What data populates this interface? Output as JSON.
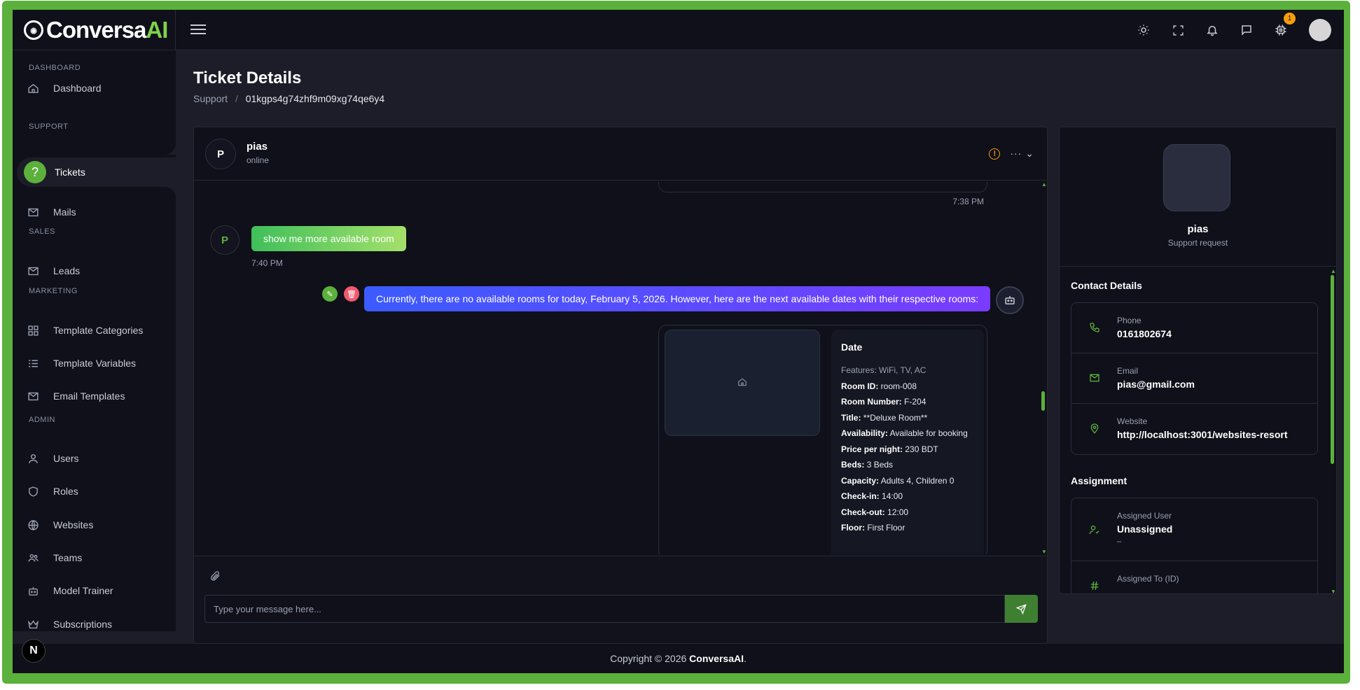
{
  "app": {
    "logo_text": "Conversa",
    "logo_accent": "AI",
    "accent_color": "#5cb03c"
  },
  "topbar": {
    "icons": [
      "sun-icon",
      "fullscreen-icon",
      "bell-icon",
      "chat-icon",
      "chip-icon"
    ],
    "chip_badge": "1"
  },
  "sidebar": {
    "sections": {
      "dashboard": "DASHBOARD",
      "support": "SUPPORT",
      "sales": "SALES",
      "marketing": "MARKETING",
      "admin": "ADMIN"
    },
    "items": {
      "dashboard": "Dashboard",
      "tickets": "Tickets",
      "mails": "Mails",
      "leads": "Leads",
      "template_categories": "Template Categories",
      "template_variables": "Template Variables",
      "email_templates": "Email Templates",
      "users": "Users",
      "roles": "Roles",
      "websites": "Websites",
      "teams": "Teams",
      "model_trainer": "Model Trainer",
      "subscriptions": "Subscriptions"
    }
  },
  "page": {
    "title": "Ticket Details",
    "breadcrumb_root": "Support",
    "breadcrumb_sep": "/",
    "breadcrumb_current": "01kgps4g74zhf9m09xg74qe6y4"
  },
  "chat": {
    "contact_initial": "P",
    "contact_name": "pias",
    "contact_status": "online",
    "prev_time": "7:38 PM",
    "user_initial": "P",
    "user_message": "show me more available room",
    "user_time": "7:40 PM",
    "bot_message": "Currently, there are no available rooms for today, February 5, 2026. However, here are the next available dates with their respective rooms:",
    "room": {
      "title": "Date",
      "features": "Features: WiFi, TV, AC",
      "fields": [
        {
          "label": "Room ID:",
          "value": "room-008"
        },
        {
          "label": "Room Number:",
          "value": "F-204"
        },
        {
          "label": "Title:",
          "value": "**Deluxe Room**"
        },
        {
          "label": "Availability:",
          "value": "Available for booking"
        },
        {
          "label": "Price per night:",
          "value": "230 BDT"
        },
        {
          "label": "Beds:",
          "value": "3 Beds"
        },
        {
          "label": "Capacity:",
          "value": "Adults 4, Children 0"
        },
        {
          "label": "Check-in:",
          "value": "14:00"
        },
        {
          "label": "Check-out:",
          "value": "12:00"
        },
        {
          "label": "Floor:",
          "value": "First Floor"
        }
      ]
    },
    "input_placeholder": "Type your message here..."
  },
  "profile": {
    "name": "pias",
    "subtitle": "Support request"
  },
  "contact_details": {
    "title": "Contact Details",
    "phone_label": "Phone",
    "phone": "0161802674",
    "email_label": "Email",
    "email": "pias@gmail.com",
    "website_label": "Website",
    "website": "http://localhost:3001/websites-resort"
  },
  "assignment": {
    "title": "Assignment",
    "user_label": "Assigned User",
    "user_value": "Unassigned",
    "user_sub": "–",
    "to_label": "Assigned To (ID)"
  },
  "footer": {
    "prefix": "Copyright © 2026 ",
    "brand": "ConversaAI",
    "suffix": "."
  },
  "next_badge": "N"
}
